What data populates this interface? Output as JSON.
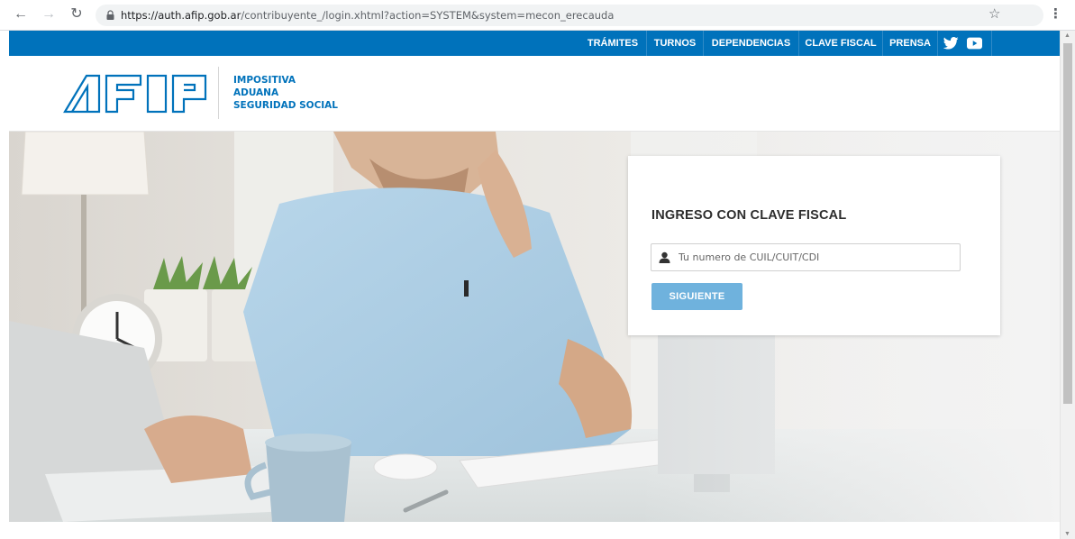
{
  "browser": {
    "url_host": "https://auth.afip.gob.ar",
    "url_path": "/contribuyente_/login.xhtml?action=SYSTEM&system=mecon_erecauda",
    "back_icon": "arrow-left-icon",
    "forward_icon": "arrow-right-icon",
    "reload_icon": "reload-icon",
    "lock_icon": "lock-icon",
    "star_icon": "star-icon",
    "menu_icon": "more-vert-icon"
  },
  "topnav": {
    "background": "#0072bb",
    "items": [
      "TRÁMITES",
      "TURNOS",
      "DEPENDENCIAS",
      "CLAVE FISCAL",
      "PRENSA"
    ],
    "social": [
      "twitter-icon",
      "youtube-icon"
    ]
  },
  "header": {
    "logo_text": "AFIP",
    "tagline": [
      "IMPOSITIVA",
      "ADUANA",
      "SEGURIDAD SOCIAL"
    ],
    "brand_color": "#0072bb"
  },
  "login": {
    "title": "INGRESO CON CLAVE FISCAL",
    "input_placeholder": "Tu numero de CUIL/CUIT/CDI",
    "input_value": "",
    "button_label": "SIGUIENTE",
    "button_color": "#6fb2dd"
  }
}
